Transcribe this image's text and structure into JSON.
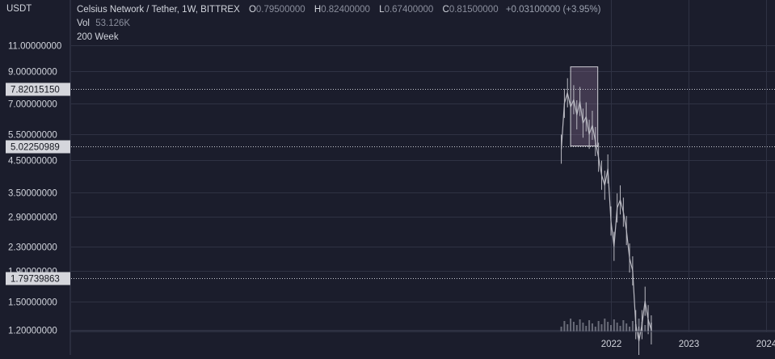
{
  "currency_label": "USDT",
  "legend": {
    "symbol": "Celsius Network / Tether, 1W, BITTREX",
    "open_key": "O",
    "open": "0.79500000",
    "high_key": "H",
    "high": "0.82400000",
    "low_key": "L",
    "low": "0.67400000",
    "close_key": "C",
    "close": "0.81500000",
    "change": "+0.03100000 (+3.95%)",
    "vol_key": "Vol",
    "vol": "53.126K",
    "indicator": "200 Week"
  },
  "price_labels": [
    {
      "text": "7.82015150",
      "value": 7.8201515
    },
    {
      "text": "5.02250989",
      "value": 5.02250989
    },
    {
      "text": "1.79739863",
      "value": 1.79739863
    }
  ],
  "highlight_box": {
    "x_start": 2021.48,
    "x_end": 2021.83,
    "y_low": 5.02250989,
    "y_high": 9.3
  },
  "colors": {
    "background": "#1b1d2c",
    "grid": "#2f3243",
    "candle": "#b9b9c2",
    "text": "#d1d4dc",
    "box_stroke": "#cfcfd6",
    "box_fill": "#8a6f93"
  },
  "chart_data": {
    "type": "line",
    "title": "Celsius Network / Tether, 1W, BITTREX",
    "ylabel": "USDT",
    "y_scale": "log",
    "x": [
      2021.36,
      2021.4,
      2021.44,
      2021.48,
      2021.52,
      2021.56,
      2021.6,
      2021.64,
      2021.68,
      2021.72,
      2021.76,
      2021.8,
      2021.84,
      2021.88,
      2021.92,
      2021.96,
      2022.0,
      2022.04,
      2022.08,
      2022.12,
      2022.16,
      2022.2,
      2022.24,
      2022.28,
      2022.32,
      2022.36,
      2022.4,
      2022.44,
      2022.48,
      2022.52
    ],
    "series": [
      {
        "values": [
          4.9,
          7.0,
          7.6,
          6.8,
          7.2,
          6.4,
          7.1,
          6.0,
          6.3,
          5.5,
          5.9,
          5.2,
          4.6,
          4.0,
          3.7,
          4.2,
          2.8,
          2.3,
          3.1,
          3.3,
          3.0,
          2.6,
          2.1,
          1.9,
          1.25,
          1.1,
          1.25,
          1.5,
          1.3,
          1.2
        ]
      }
    ],
    "yticks": [
      "1.20000000",
      "1.50000000",
      "1.90000000",
      "2.30000000",
      "2.90000000",
      "3.50000000",
      "4.50000000",
      "5.50000000",
      "7.00000000",
      "9.00000000",
      "11.00000000"
    ],
    "ytick_values": [
      1.2,
      1.5,
      1.9,
      2.3,
      2.9,
      3.5,
      4.5,
      5.5,
      7.0,
      9.0,
      11.0
    ],
    "xticks": [
      "2022",
      "2023",
      "2024"
    ],
    "xtick_values": [
      2022.0,
      2023.0,
      2024.0
    ],
    "grid": true
  }
}
